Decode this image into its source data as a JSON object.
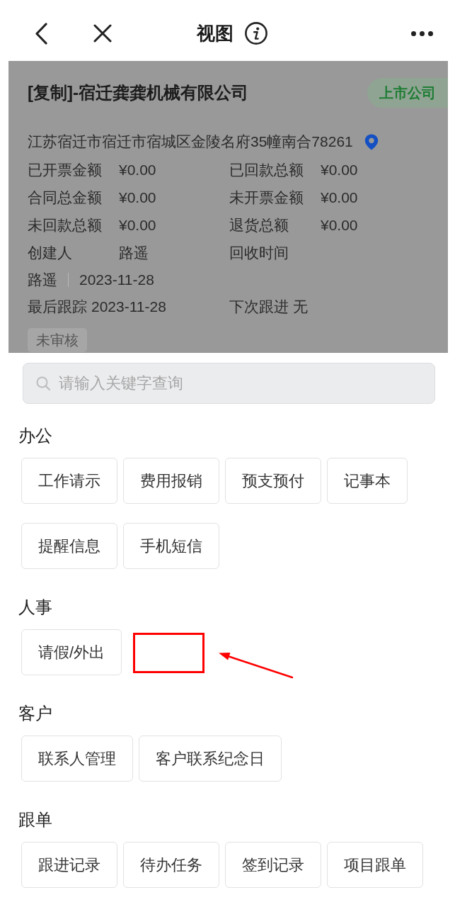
{
  "header": {
    "title": "视图"
  },
  "company": {
    "name": "[复制]-宿迁龚龚机械有限公司",
    "badge": "上市公司",
    "address": "江苏宿迁市宿迁市宿城区金陵名府35幢南合78261",
    "fields": [
      {
        "label": "已开票金额",
        "value": "¥0.00"
      },
      {
        "label": "已回款总额",
        "value": "¥0.00"
      },
      {
        "label": "合同总金额",
        "value": "¥0.00"
      },
      {
        "label": "未开票金额",
        "value": "¥0.00"
      },
      {
        "label": "未回款总额",
        "value": "¥0.00"
      },
      {
        "label": "退货总额",
        "value": "¥0.00"
      },
      {
        "label": "创建人",
        "value": "路遥"
      },
      {
        "label": "回收时间"
      }
    ],
    "creator": "路遥",
    "created_date": "2023-11-28",
    "follow": [
      {
        "label": "最后跟踪",
        "value": "2023-11-28"
      },
      {
        "label": "下次跟进",
        "value": "无"
      }
    ],
    "status_tag": "未审核"
  },
  "search": {
    "placeholder": "请输入关键字查询"
  },
  "sections": [
    {
      "title": "办公",
      "marked": false,
      "items": [
        "工作请示",
        "费用报销",
        "预支预付",
        "记事本",
        "提醒信息",
        "手机短信"
      ]
    },
    {
      "title": "人事",
      "marked": true,
      "items": [
        "请假/外出"
      ]
    },
    {
      "title": "客户",
      "marked": false,
      "items": [
        "联系人管理",
        "客户联系纪念日"
      ]
    },
    {
      "title": "跟单",
      "marked": false,
      "items": [
        "跟进记录",
        "待办任务",
        "签到记录",
        "项目跟单"
      ]
    }
  ]
}
